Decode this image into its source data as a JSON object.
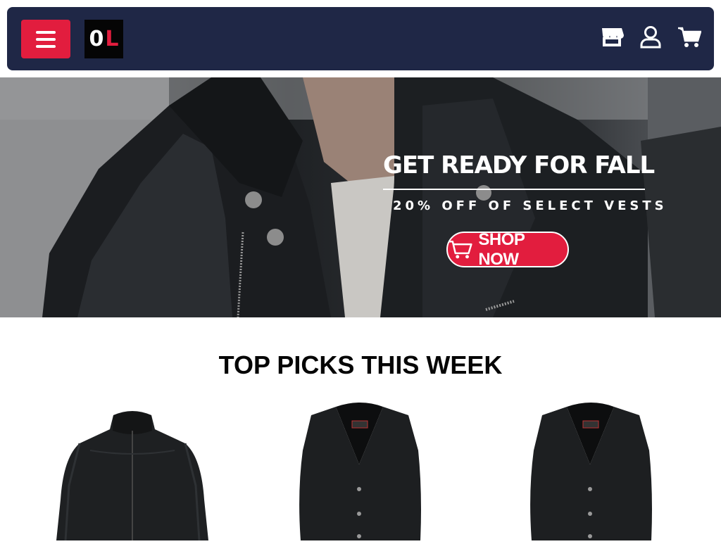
{
  "header": {
    "menu_icon": "hamburger-icon",
    "logo_text_o": "0",
    "logo_text_l": "L",
    "icons": [
      "store-icon",
      "user-icon",
      "cart-icon"
    ],
    "colors": {
      "nav_bg": "#1f2746",
      "accent": "#e21d3e"
    }
  },
  "banner": {
    "title": "GET READY FOR FALL",
    "subtitle": "20% OFF OF SELECT VESTS",
    "cta_label": "SHOP NOW",
    "cta_icon": "cart-icon"
  },
  "section": {
    "title": "TOP PICKS THIS WEEK"
  },
  "products": [
    {
      "type": "leather-jacket-image"
    },
    {
      "type": "leather-vest-image"
    },
    {
      "type": "leather-vest-image"
    }
  ]
}
